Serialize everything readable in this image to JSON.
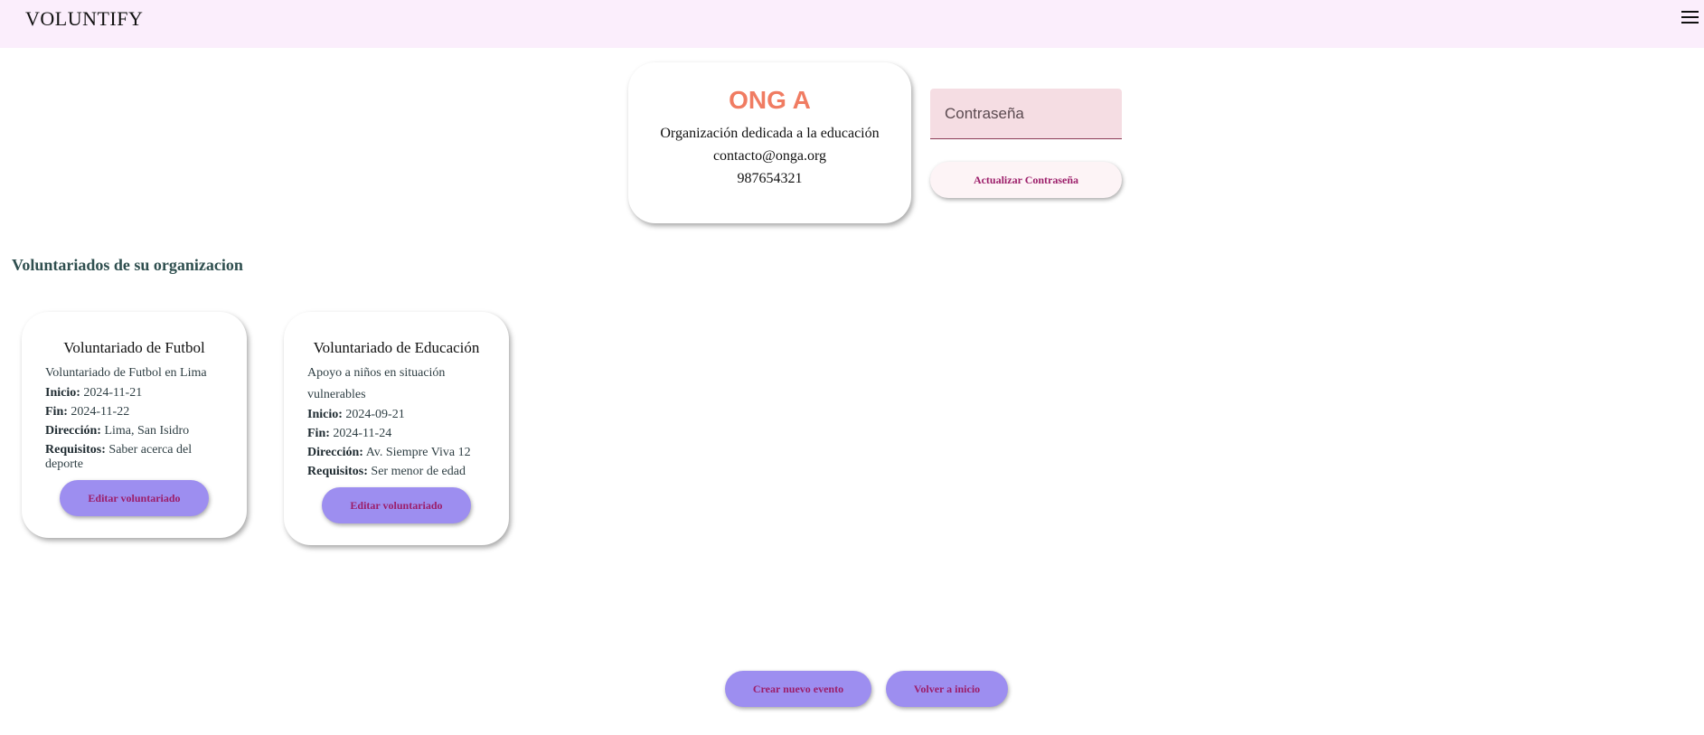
{
  "header": {
    "brand": "VOLUNTIFY",
    "menu_icon": "hamburger-menu-icon"
  },
  "organization": {
    "name": "ONG A",
    "description": "Organización dedicada a la educación",
    "email": "contacto@onga.org",
    "phone": "987654321"
  },
  "password": {
    "placeholder": "Contraseña",
    "button_label": "Actualizar Contraseña"
  },
  "section_title": "Voluntariados de su organizacion",
  "field_labels": {
    "start": "Inicio:",
    "end": "Fin:",
    "address": "Dirección:",
    "requirements": "Requisitos:"
  },
  "volunteerings": [
    {
      "title": "Voluntariado de Futbol",
      "description": "Voluntariado de Futbol en Lima",
      "start": "2024-11-21",
      "end": "2024-11-22",
      "address": "Lima, San Isidro",
      "requirements": "Saber acerca del deporte",
      "edit_label": "Editar voluntariado"
    },
    {
      "title": "Voluntariado de Educación",
      "description": "Apoyo a niños en situación vulnerables",
      "start": "2024-09-21",
      "end": "2024-11-24",
      "address": "Av. Siempre Viva 12",
      "requirements": "Ser menor de edad",
      "edit_label": "Editar voluntariado"
    }
  ],
  "actions": {
    "create_label": "Crear nuevo evento",
    "home_label": "Volver a inicio"
  },
  "colors": {
    "header_bg": "#fbeefc",
    "org_name": "#f07c62",
    "button_bg": "#9d8ef0",
    "button_text": "#9c1e6a",
    "section_title": "#2f4f4f"
  }
}
